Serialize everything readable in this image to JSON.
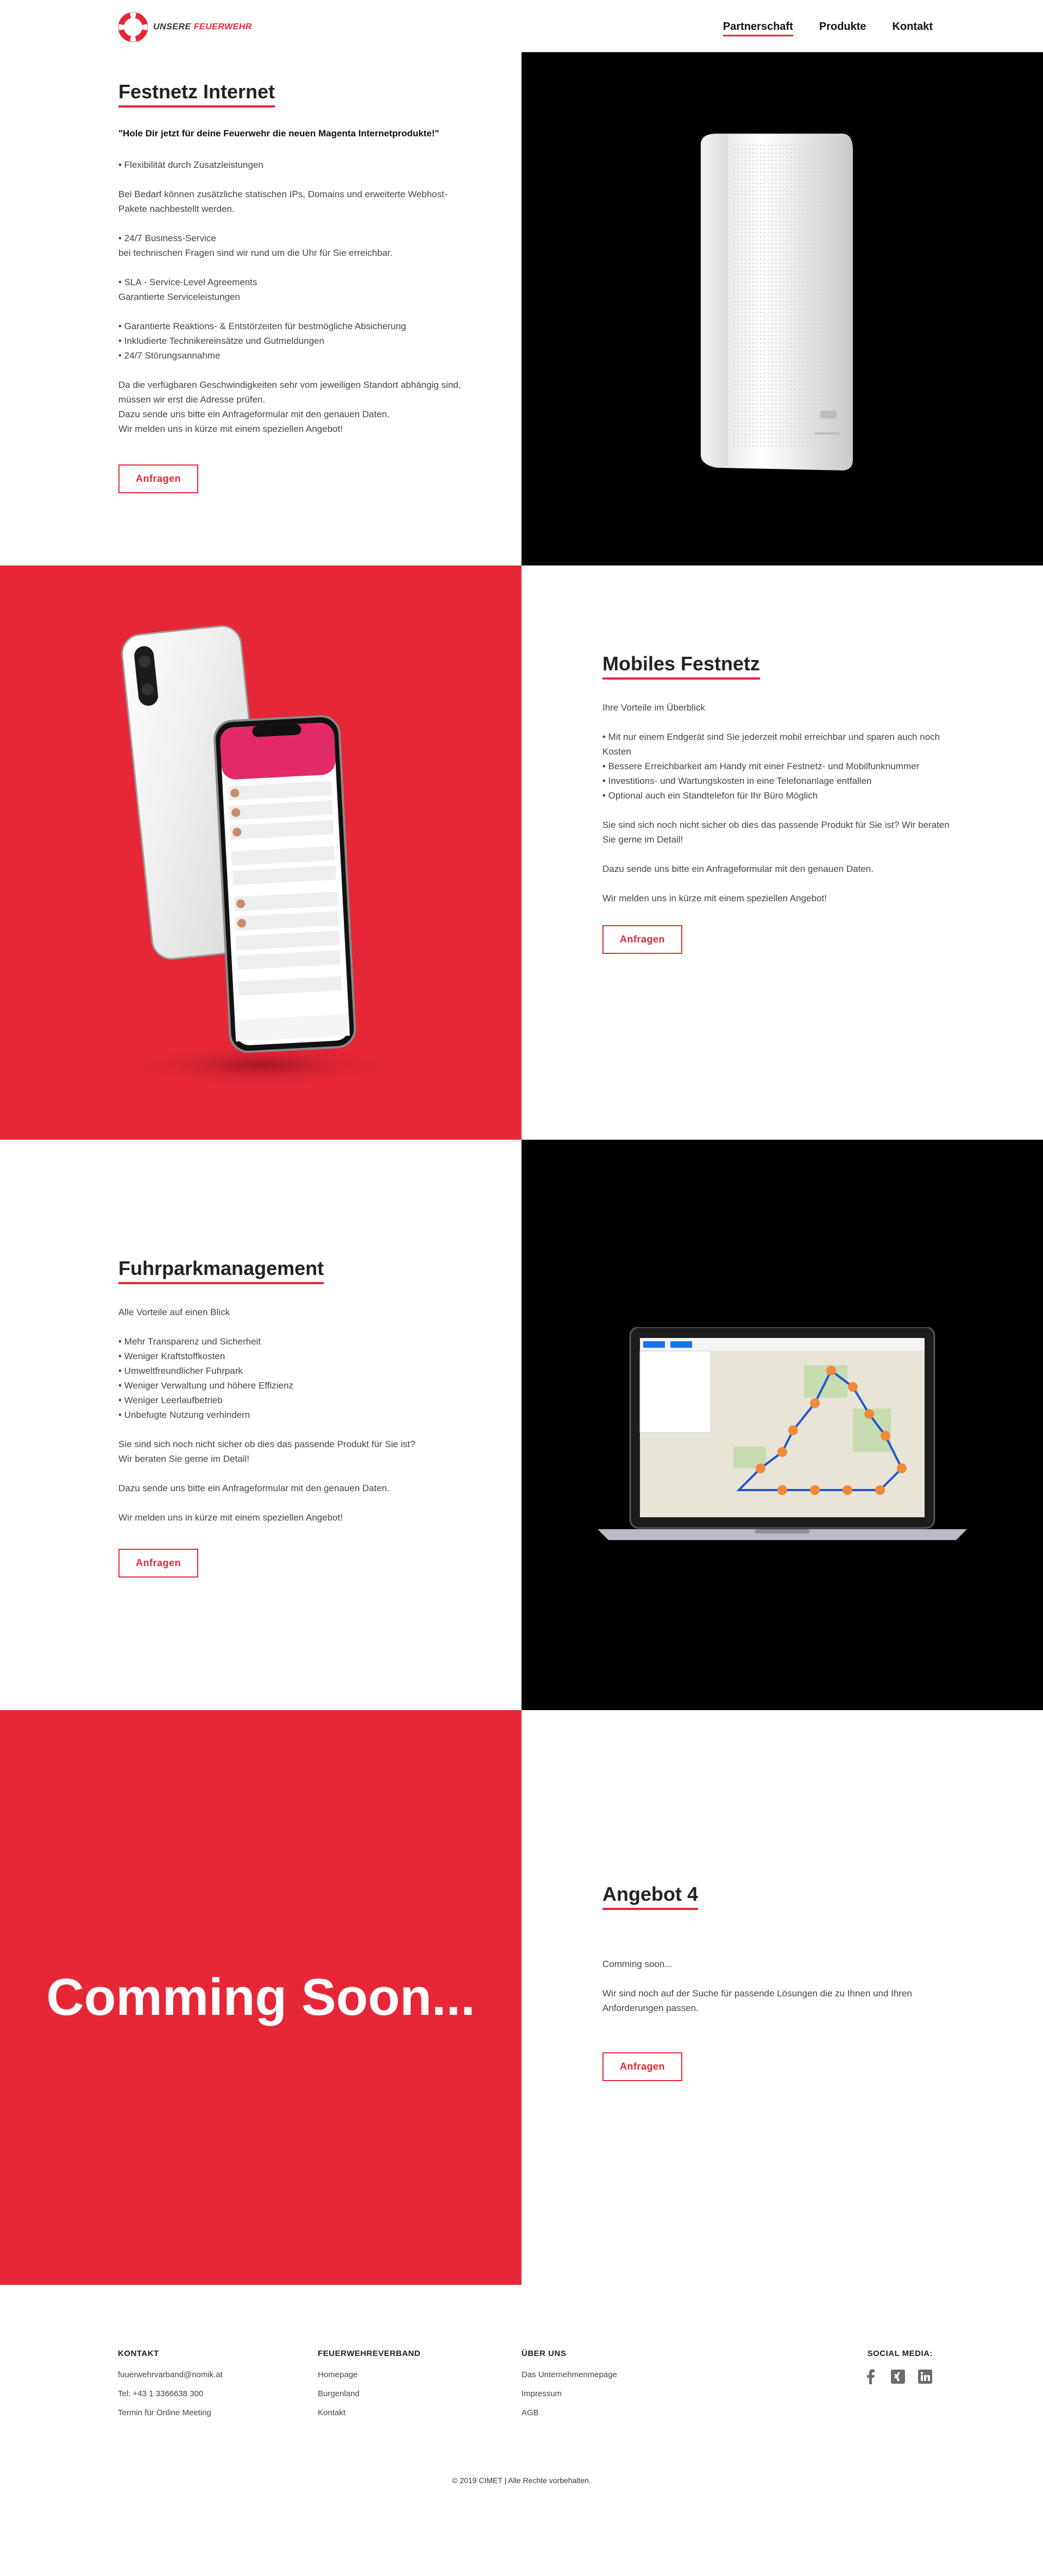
{
  "brand": {
    "logo_line1": "UNSERE",
    "logo_line2": "FEUERWEHR",
    "accent": "#e62737"
  },
  "nav": {
    "items": [
      {
        "label": "Partnerschaft"
      },
      {
        "label": "Produkte"
      },
      {
        "label": "Kontakt"
      }
    ]
  },
  "section1": {
    "title": "Festnetz Internet",
    "tagline": "\"Hole Dir jetzt für deine Feuerwehr die neuen Magenta Internetprodukte!\"",
    "body": "• Flexibilität durch Zusatzleistungen\n\nBei Bedarf können zusätzliche statischen IPs, Domains und erweiterte Webhost-Pakete nachbestellt werden.\n\n• 24/7 Business-Service\nbei technischen Fragen sind wir rund um die Uhr für Sie erreichbar.\n\n• SLA - Service-Level Agreements\nGarantierte Serviceleistungen\n\n• Garantierte Reaktions- & Entstörzeiten für bestmögliche Absicherung\n• Inkludierte Technikereinsätze und Gutmeldungen\n• 24/7 Störungsannahme\n\nDa die verfügbaren Geschwindigkeiten sehr vom jeweiligen Standort abhängig sind, müssen wir erst die Adresse prüfen.\nDazu sende uns bitte ein Anfrageformular mit den genauen Daten.\nWir melden uns in kürze mit einem speziellen Angebot!",
    "button": "Anfragen"
  },
  "section2": {
    "title": "Mobiles Festnetz",
    "body": "Ihre Vorteile im Überblick\n\n• Mit nur einem Endgerät sind Sie jederzeit mobil erreichbar und sparen auch noch Kosten\n• Bessere Erreichbarkeit am Handy mit einer Festnetz- und Mobilfunknummer\n• Investitions- und Wartungskosten in eine Telefonanlage entfallen\n• Optional auch ein Standtelefon für Ihr Büro Möglich\n\nSie sind sich noch nicht sicher ob dies das passende Produkt für Sie ist? Wir beraten Sie gerne im Detail!\n\nDazu sende uns bitte ein Anfrageformular mit den genauen Daten.\n\nWir melden uns in kürze mit einem speziellen Angebot!",
    "button": "Anfragen"
  },
  "section3": {
    "title": "Fuhrparkmanagement",
    "body": "Alle Vorteile auf einen Blick\n\n• Mehr Transparenz und Sicherheit\n• Weniger Kraftstoffkosten\n• Umweltfreundlicher Fuhrpark\n• Weniger Verwaltung und höhere Effizienz\n• Weniger Leerlaufbetrieb\n• Unbefugte Nutzung verhindern\n\nSie sind sich noch nicht sicher ob dies das passende Produkt für Sie ist?\nWir beraten Sie gerne im Detail!\n\nDazu sende uns bitte ein Anfrageformular mit den genauen Daten.\n\nWir melden uns in kürze mit einem speziellen Angebot!",
    "button": "Anfragen"
  },
  "section4": {
    "coming_soon": "Comming Soon...",
    "title": "Angebot 4",
    "body": "Comming soon...\n\nWir sind noch auf der Suche für passende Lösungen die zu Ihnen und Ihren Anforderungen passen.",
    "button": "Anfragen"
  },
  "footer": {
    "kontakt": {
      "heading": "KONTAKT",
      "email": "fuuerwehrvarband@nomik.at",
      "phone": "Tel: +43 1 3366638 300",
      "meeting": "Termin für Online Meeting"
    },
    "verband": {
      "heading": "FEUERWEHREVERBAND",
      "links": [
        "Homepage",
        "Burgenland",
        "Kontakt"
      ]
    },
    "ueber": {
      "heading": "ÜBER UNS",
      "links": [
        "Das Unternehmenmepage",
        "Impressum",
        "AGB"
      ]
    },
    "social": {
      "heading": "SOCIAL MEDIA:",
      "icons": [
        "facebook-icon",
        "xing-icon",
        "linkedin-icon"
      ]
    },
    "copyright": "© 2019 CIMET | Alle Rechte vorbehalten."
  }
}
